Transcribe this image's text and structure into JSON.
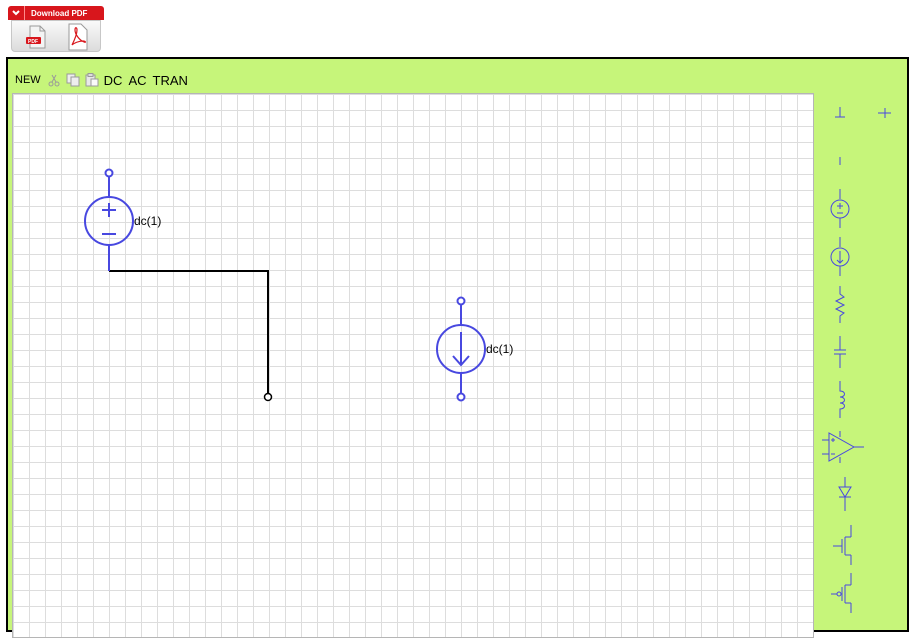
{
  "download": {
    "label": "Download PDF"
  },
  "toolbar": {
    "new_label": "NEW",
    "dc_label": "DC",
    "ac_label": "AC",
    "tran_label": "TRAN"
  },
  "components": {
    "voltage_source": {
      "value_label": "dc(1)"
    },
    "current_source": {
      "value_label": "dc(1)"
    }
  },
  "palette": [
    "ground-icon",
    "node-connection-icon",
    "label-icon",
    "voltage-source-icon",
    "current-source-icon",
    "resistor-icon",
    "capacitor-icon",
    "inductor-icon",
    "op-amp-icon",
    "diode-icon",
    "nmos-icon",
    "pmos-icon"
  ],
  "colors": {
    "editor_bg": "#c6f57a",
    "component": "#4848e0",
    "wire": "#000000",
    "grid": "#dddddd",
    "pdf_red": "#d8161c"
  }
}
